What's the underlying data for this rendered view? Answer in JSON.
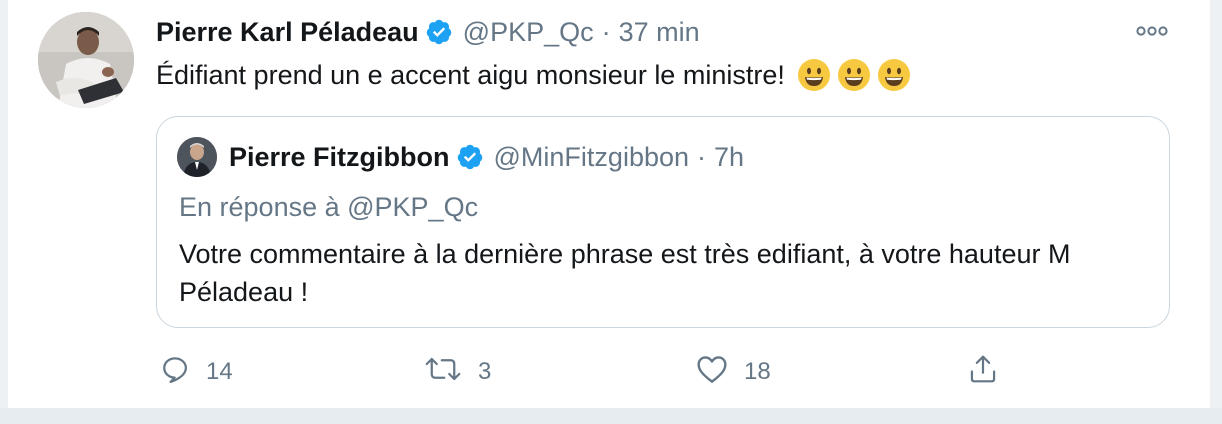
{
  "tweet": {
    "author_name": "Pierre Karl Péladeau",
    "handle": "@PKP_Qc",
    "separator": "·",
    "time": "37 min",
    "text": "Édifiant prend un e accent aigu monsieur le ministre!",
    "emojis": [
      "grinning-face",
      "grinning-face",
      "grinning-face"
    ]
  },
  "quoted": {
    "author_name": "Pierre Fitzgibbon",
    "handle": "@MinFitzgibbon",
    "separator": "·",
    "time": "7h",
    "reply_to": "En réponse à @PKP_Qc",
    "text": "Votre commentaire à la dernière phrase est très edifiant, à votre hauteur M Péladeau !"
  },
  "actions": {
    "reply_count": "14",
    "retweet_count": "3",
    "like_count": "18"
  },
  "colors": {
    "verified_blue": "#1da1f2",
    "muted_text": "#657786",
    "border": "#ccd6dd",
    "background_edge": "#e6ecf0"
  },
  "icons": [
    "more-icon",
    "verified-badge-icon",
    "reply-icon",
    "retweet-icon",
    "like-icon",
    "share-icon"
  ]
}
